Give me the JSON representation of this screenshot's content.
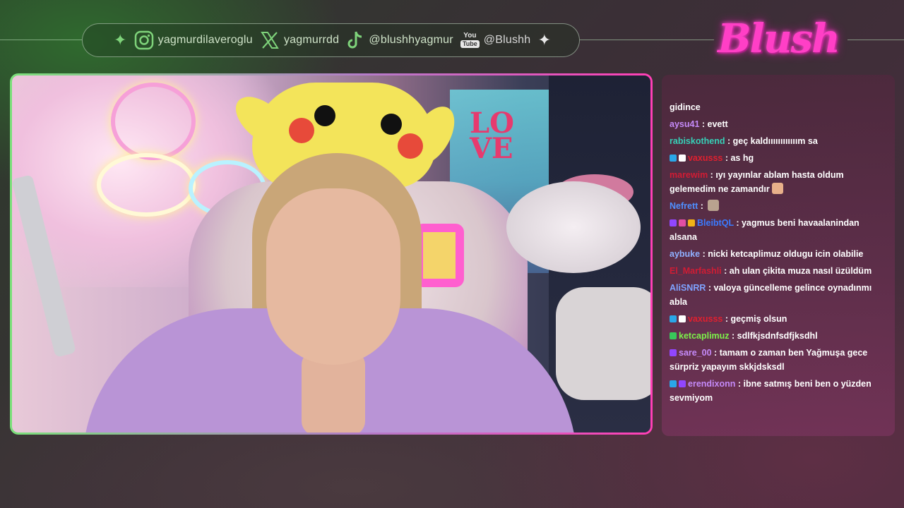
{
  "colors": {
    "accent_pink": "#ff3fc6",
    "accent_green": "#7be07a"
  },
  "socials": [
    {
      "platform": "instagram",
      "icon": "instagram-icon",
      "handle": "yagmurdilaveroglu"
    },
    {
      "platform": "x",
      "icon": "x-icon",
      "handle": "yagmurrdd"
    },
    {
      "platform": "tiktok",
      "icon": "tiktok-icon",
      "handle": "@blushhyagmur"
    },
    {
      "platform": "youtube",
      "icon": "youtube-icon",
      "handle": "@Blushh",
      "badge_you": "You",
      "badge_tube": "Tube"
    }
  ],
  "logo": {
    "text": "Blush"
  },
  "webcam": {
    "love_sign": "LO\nVE"
  },
  "chat": {
    "messages": [
      {
        "user": "",
        "text": "gidince",
        "user_color": "#ffffff"
      },
      {
        "user": "aysu41",
        "text": "evett",
        "user_color": "#c58af9"
      },
      {
        "user": "rabiskothend",
        "text": "geç kaldıııııııııııım sa",
        "user_color": "#36d1b8"
      },
      {
        "user": "vaxusss",
        "text": "as hg",
        "user_color": "#e0202f",
        "badges": [
          "#2aa7e8",
          "#ffffff"
        ]
      },
      {
        "user": "marewim",
        "text": "ıyı yayınlar ablam hasta oldum gelemedim ne zamandır",
        "user_color": "#d01c34",
        "emote": "#e8b08a"
      },
      {
        "user": "Nefrett",
        "text": "",
        "user_color": "#4f8fff",
        "emote": "#b9a38f"
      },
      {
        "user": "BleibtQL",
        "text": "yagmus beni havaalanindan alsana",
        "user_color": "#3b7bff",
        "badges": [
          "#9146ff",
          "#e24fa3",
          "#f2b417"
        ]
      },
      {
        "user": "aybuke",
        "text": "nicki ketcaplimuz oldugu icin olabilie",
        "user_color": "#8fb0ff"
      },
      {
        "user": "El_Marfashli",
        "text": "ah ulan çikita muza nasıl üzüldüm",
        "user_color": "#d01c34"
      },
      {
        "user": "AliSNRR",
        "text": "valoya güncelleme gelince oynadınmı abla",
        "user_color": "#7fa3ff"
      },
      {
        "user": "vaxusss",
        "text": "geçmiş olsun",
        "user_color": "#e0202f",
        "badges": [
          "#2aa7e8",
          "#ffffff"
        ]
      },
      {
        "user": "ketcaplimuz",
        "text": "sdlfkjsdnfsdfjksdhl",
        "user_color": "#7cf24a",
        "badges": [
          "#38c85a"
        ]
      },
      {
        "user": "sare_00",
        "text": "tamam o zaman ben Yağmuşa gece sürpriz yapayım skkjdsksdl",
        "user_color": "#c58af9",
        "badges": [
          "#9146ff"
        ]
      },
      {
        "user": "erendixonn",
        "text": "ibne satmış beni ben o yüzden sevmiyom",
        "user_color": "#c58af9",
        "badges": [
          "#2aa7e8",
          "#9146ff"
        ]
      }
    ]
  }
}
